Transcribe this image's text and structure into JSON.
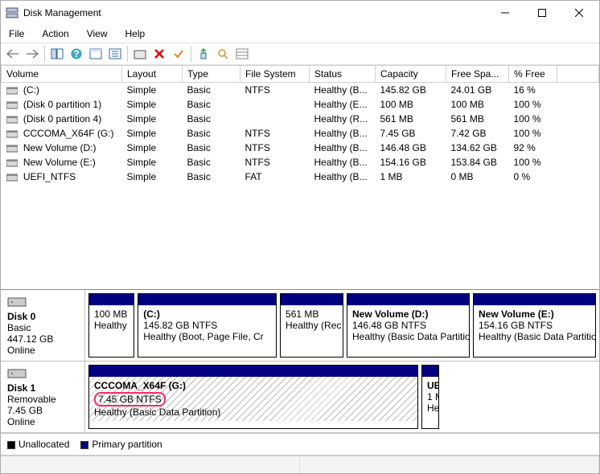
{
  "window": {
    "title": "Disk Management"
  },
  "menu": {
    "file": "File",
    "action": "Action",
    "view": "View",
    "help": "Help"
  },
  "columns": {
    "volume": "Volume",
    "layout": "Layout",
    "type": "Type",
    "fs": "File System",
    "status": "Status",
    "capacity": "Capacity",
    "free": "Free Spa...",
    "pct": "% Free"
  },
  "volumes": [
    {
      "name": "(C:)",
      "layout": "Simple",
      "type": "Basic",
      "fs": "NTFS",
      "status": "Healthy (B...",
      "capacity": "145.82 GB",
      "free": "24.01 GB",
      "pct": "16 %"
    },
    {
      "name": "(Disk 0 partition 1)",
      "layout": "Simple",
      "type": "Basic",
      "fs": "",
      "status": "Healthy (E...",
      "capacity": "100 MB",
      "free": "100 MB",
      "pct": "100 %"
    },
    {
      "name": "(Disk 0 partition 4)",
      "layout": "Simple",
      "type": "Basic",
      "fs": "",
      "status": "Healthy (R...",
      "capacity": "561 MB",
      "free": "561 MB",
      "pct": "100 %"
    },
    {
      "name": "CCCOMA_X64F (G:)",
      "layout": "Simple",
      "type": "Basic",
      "fs": "NTFS",
      "status": "Healthy (B...",
      "capacity": "7.45 GB",
      "free": "7.42 GB",
      "pct": "100 %"
    },
    {
      "name": "New Volume (D:)",
      "layout": "Simple",
      "type": "Basic",
      "fs": "NTFS",
      "status": "Healthy (B...",
      "capacity": "146.48 GB",
      "free": "134.62 GB",
      "pct": "92 %"
    },
    {
      "name": "New Volume (E:)",
      "layout": "Simple",
      "type": "Basic",
      "fs": "NTFS",
      "status": "Healthy (B...",
      "capacity": "154.16 GB",
      "free": "153.84 GB",
      "pct": "100 %"
    },
    {
      "name": "UEFI_NTFS",
      "layout": "Simple",
      "type": "Basic",
      "fs": "FAT",
      "status": "Healthy (B...",
      "capacity": "1 MB",
      "free": "0 MB",
      "pct": "0 %"
    }
  ],
  "disks": {
    "d0": {
      "name": "Disk 0",
      "type": "Basic",
      "size": "447.12 GB",
      "status": "Online",
      "p0": {
        "name": "",
        "line2": "100 MB",
        "line3": "Healthy"
      },
      "p1": {
        "name": "(C:)",
        "line2": "145.82 GB NTFS",
        "line3": "Healthy (Boot, Page File, Cr"
      },
      "p2": {
        "name": "",
        "line2": "561 MB",
        "line3": "Healthy (Rec"
      },
      "p3": {
        "name": "New Volume  (D:)",
        "line2": "146.48 GB NTFS",
        "line3": "Healthy (Basic Data Partitio"
      },
      "p4": {
        "name": "New Volume  (E:)",
        "line2": "154.16 GB NTFS",
        "line3": "Healthy (Basic Data Partition"
      }
    },
    "d1": {
      "name": "Disk 1",
      "type": "Removable",
      "size": "7.45 GB",
      "status": "Online",
      "p0": {
        "name": "CCCOMA_X64F  (G:)",
        "line2": "7.45 GB NTFS",
        "line3": "Healthy (Basic Data Partition)"
      },
      "p1": {
        "name": "UE",
        "line2": "1 M",
        "line3": "He"
      }
    }
  },
  "legend": {
    "unallocated": "Unallocated",
    "primary": "Primary partition"
  }
}
